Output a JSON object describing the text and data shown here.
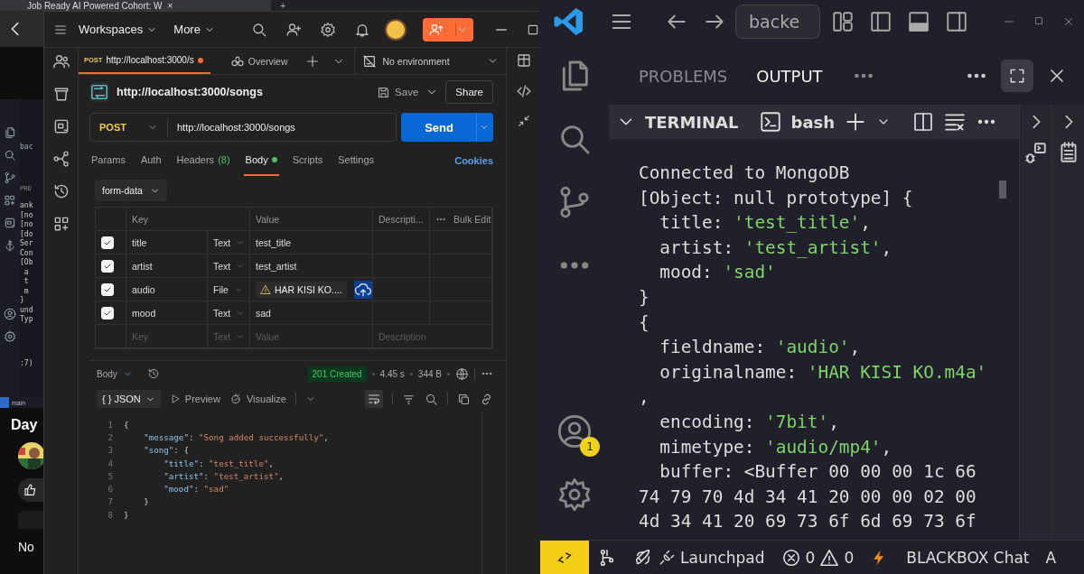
{
  "browser": {
    "tab_title": "Job Ready AI Powered Cohort: W",
    "close": "×",
    "new_tab": "+",
    "bg_tab": "bac",
    "bg_panel": "PRO",
    "bg_lines": [
      "ank",
      "[no",
      "[no",
      "[do",
      "Ser",
      "Con",
      "[Ob",
      " a",
      " t",
      " m",
      "}",
      "und",
      "Typ"
    ],
    "bg_line_end": ":7)",
    "bg_branch": "main",
    "video_title": "Day",
    "bottom_text": "No"
  },
  "postman": {
    "menus": [
      "Workspaces",
      "More"
    ],
    "tab": {
      "method": "POST",
      "url": "http://localhost:3000/s",
      "unsaved": true
    },
    "overview": "Overview",
    "environment": "No environment",
    "request": {
      "title": "http://localhost:3000/songs",
      "save": "Save",
      "share": "Share",
      "method": "POST",
      "url": "http://localhost:3000/songs",
      "send": "Send"
    },
    "request_tabs": [
      {
        "label": "Params",
        "selected": false
      },
      {
        "label": "Auth",
        "selected": false
      },
      {
        "label": "Headers",
        "count": "(8)",
        "selected": false
      },
      {
        "label": "Body",
        "dot": true,
        "selected": true
      },
      {
        "label": "Scripts",
        "selected": false
      },
      {
        "label": "Settings",
        "selected": false
      }
    ],
    "cookies": "Cookies",
    "body_mode": "form-data",
    "table": {
      "columns": [
        "Key",
        "Value",
        "Descripti..."
      ],
      "bulk_edit": "Bulk Edit",
      "rows": [
        {
          "checked": true,
          "key": "title",
          "type": "Text",
          "kind": "text",
          "value": "test_title"
        },
        {
          "checked": true,
          "key": "artist",
          "type": "Text",
          "kind": "text",
          "value": "test_artist"
        },
        {
          "checked": true,
          "key": "audio",
          "type": "File",
          "kind": "file",
          "value": "HAR KISI KO....",
          "missing": true
        },
        {
          "checked": true,
          "key": "mood",
          "type": "Text",
          "kind": "text",
          "value": "sad"
        }
      ],
      "new_row": {
        "key_placeholder": "Key",
        "type": "Text",
        "value_placeholder": "Value",
        "description_placeholder": "Description"
      }
    },
    "response": {
      "label": "Body",
      "status": "201 Created",
      "time": "4.45 s",
      "size": "344 B",
      "format_icon": "{ }",
      "format": "JSON",
      "preview": "Preview",
      "visualize": "Visualize",
      "lines": [
        {
          "n": "1",
          "parts": [
            {
              "kind": "punct",
              "text": "{"
            }
          ]
        },
        {
          "n": "2",
          "parts": [
            {
              "kind": "key",
              "text": "    \"message\""
            },
            {
              "kind": "punct",
              "text": ": "
            },
            {
              "kind": "string",
              "text": "\"Song added successfully\""
            },
            {
              "kind": "punct",
              "text": ","
            }
          ]
        },
        {
          "n": "3",
          "parts": [
            {
              "kind": "key",
              "text": "    \"song\""
            },
            {
              "kind": "punct",
              "text": ": {"
            }
          ]
        },
        {
          "n": "4",
          "parts": [
            {
              "kind": "key",
              "text": "        \"title\""
            },
            {
              "kind": "punct",
              "text": ": "
            },
            {
              "kind": "string",
              "text": "\"test_title\""
            },
            {
              "kind": "punct",
              "text": ","
            }
          ]
        },
        {
          "n": "5",
          "parts": [
            {
              "kind": "key",
              "text": "        \"artist\""
            },
            {
              "kind": "punct",
              "text": ": "
            },
            {
              "kind": "string",
              "text": "\"test_artist\""
            },
            {
              "kind": "punct",
              "text": ","
            }
          ]
        },
        {
          "n": "6",
          "parts": [
            {
              "kind": "key",
              "text": "        \"mood\""
            },
            {
              "kind": "punct",
              "text": ": "
            },
            {
              "kind": "string",
              "text": "\"sad\""
            }
          ]
        },
        {
          "n": "7",
          "parts": [
            {
              "kind": "punct",
              "text": "    }"
            }
          ]
        },
        {
          "n": "8",
          "parts": [
            {
              "kind": "punct",
              "text": "}"
            }
          ]
        }
      ]
    }
  },
  "vscode": {
    "search": "backe",
    "account_badge": "1",
    "panel_tabs": [
      {
        "label": "PROBLEMS",
        "selected": false
      },
      {
        "label": "OUTPUT",
        "selected": true
      }
    ],
    "terminal": {
      "title": "TERMINAL",
      "shell": "bash",
      "lines": [
        [
          {
            "kind": "plain",
            "text": "Connected to MongoDB"
          }
        ],
        [
          {
            "kind": "plain",
            "text": "[Object: null prototype] {"
          }
        ],
        [
          {
            "kind": "plain",
            "text": "  title: "
          },
          {
            "kind": "string",
            "text": "'test_title'"
          },
          {
            "kind": "plain",
            "text": ","
          }
        ],
        [
          {
            "kind": "plain",
            "text": "  artist: "
          },
          {
            "kind": "string",
            "text": "'test_artist'"
          },
          {
            "kind": "plain",
            "text": ","
          }
        ],
        [
          {
            "kind": "plain",
            "text": "  mood: "
          },
          {
            "kind": "string",
            "text": "'sad'"
          }
        ],
        [
          {
            "kind": "plain",
            "text": "}"
          }
        ],
        [
          {
            "kind": "plain",
            "text": "{"
          }
        ],
        [
          {
            "kind": "plain",
            "text": "  fieldname: "
          },
          {
            "kind": "string",
            "text": "'audio'"
          },
          {
            "kind": "plain",
            "text": ","
          }
        ],
        [
          {
            "kind": "plain",
            "text": "  originalname: "
          },
          {
            "kind": "string",
            "text": "'HAR KISI KO.m4a'"
          }
        ],
        [
          {
            "kind": "plain",
            "text": ","
          }
        ],
        [
          {
            "kind": "plain",
            "text": "  encoding: "
          },
          {
            "kind": "string",
            "text": "'7bit'"
          },
          {
            "kind": "plain",
            "text": ","
          }
        ],
        [
          {
            "kind": "plain",
            "text": "  mimetype: "
          },
          {
            "kind": "string",
            "text": "'audio/mp4'"
          },
          {
            "kind": "plain",
            "text": ","
          }
        ],
        [
          {
            "kind": "plain",
            "text": "  buffer: <Buffer 00 00 00 1c 66"
          }
        ],
        [
          {
            "kind": "plain",
            "text": "74 79 70 4d 34 41 20 00 00 02 00"
          }
        ],
        [
          {
            "kind": "plain",
            "text": "4d 34 41 20 69 73 6f 6d 69 73 6f"
          }
        ]
      ]
    },
    "status": {
      "launchpad": "Launchpad",
      "errors": "0",
      "warnings": "0",
      "chat": "BLACKBOX Chat",
      "cut": "A"
    }
  }
}
